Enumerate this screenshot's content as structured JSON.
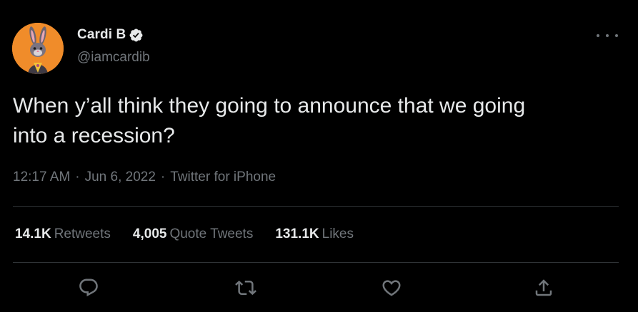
{
  "user": {
    "display_name": "Cardi B",
    "handle": "@iamcardib",
    "verified": true
  },
  "tweet": {
    "text": "When y’all think they going to announce that we going\ninto a recession?",
    "time": "12:17 AM",
    "separator": "·",
    "date": "Jun 6, 2022",
    "source": "Twitter for iPhone"
  },
  "stats": {
    "retweets": {
      "count": "14.1K",
      "label": "Retweets"
    },
    "quotes": {
      "count": "4,005",
      "label": "Quote Tweets"
    },
    "likes": {
      "count": "131.1K",
      "label": "Likes"
    }
  },
  "icons": {
    "reply": "reply-icon",
    "retweet": "retweet-icon",
    "like": "heart-icon",
    "share": "share-icon",
    "more": "more-icon",
    "verified": "verified-badge-icon"
  },
  "colors": {
    "background": "#000000",
    "text_primary": "#e7e9ea",
    "text_secondary": "#71767b",
    "divider": "#2f3336",
    "avatar_bg": "#f08c2a"
  }
}
